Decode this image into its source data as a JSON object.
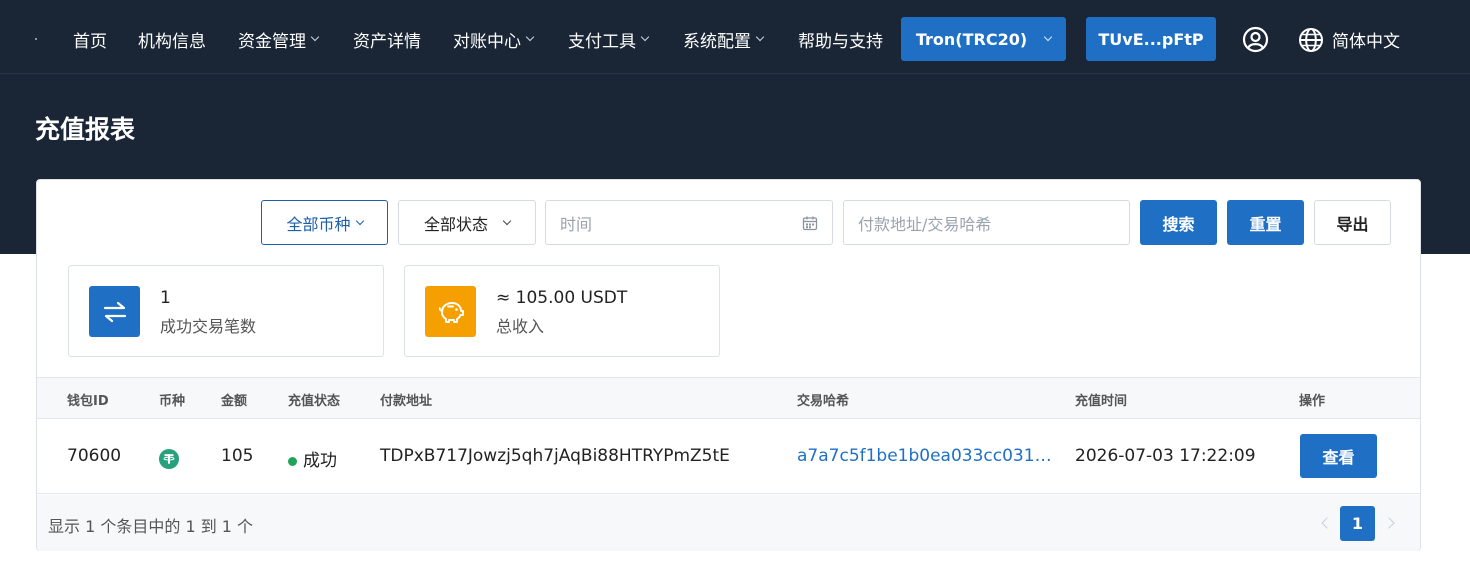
{
  "nav": {
    "items": [
      {
        "label": "首页",
        "dropdown": false
      },
      {
        "label": "机构信息",
        "dropdown": false
      },
      {
        "label": "资金管理",
        "dropdown": true
      },
      {
        "label": "资产详情",
        "dropdown": false
      },
      {
        "label": "对账中心",
        "dropdown": true
      },
      {
        "label": "支付工具",
        "dropdown": true
      },
      {
        "label": "系统配置",
        "dropdown": true
      },
      {
        "label": "帮助与支持",
        "dropdown": false
      }
    ],
    "network_label": "Tron(TRC20)",
    "wallet_label": "TUvE...pFtP",
    "language_label": "简体中文",
    "user_icon": "user-circle-icon",
    "globe_icon": "globe-icon"
  },
  "page": {
    "title": "充值报表"
  },
  "filters": {
    "currency_label": "全部币种",
    "status_label": "全部状态",
    "time_placeholder": "时间",
    "search_placeholder": "付款地址/交易哈希",
    "search_button": "搜索",
    "reset_button": "重置",
    "export_button": "导出"
  },
  "stats": [
    {
      "value": "1",
      "label": "成功交易笔数",
      "icon": "swap-arrows-icon",
      "color": "#1f6fc5"
    },
    {
      "value": "≈ 105.00 USDT",
      "label": "总收入",
      "icon": "piggy-bank-icon",
      "color": "#f5a000"
    }
  ],
  "table": {
    "headers": [
      "钱包ID",
      "币种",
      "金额",
      "充值状态",
      "付款地址",
      "交易哈希",
      "充值时间",
      "操作"
    ],
    "rows": [
      {
        "wallet_id": "70600",
        "currency_icon": "tether-icon",
        "amount": "105",
        "status": "成功",
        "payer_address": "TDPxB717Jowzj5qh7jAqBi88HTRYPmZ5tE",
        "tx_hash": "a7a7c5f1be1b0ea033cc031…",
        "time": "2026-07-03 17:22:09",
        "action_label": "查看"
      }
    ]
  },
  "pagination": {
    "summary": "显示 1 个条目中的 1 到 1 个",
    "current_page": "1"
  },
  "colors": {
    "header_bg": "#1a2536",
    "accent": "#1f6fc5",
    "success": "#22a35a",
    "warning": "#f5a000"
  }
}
